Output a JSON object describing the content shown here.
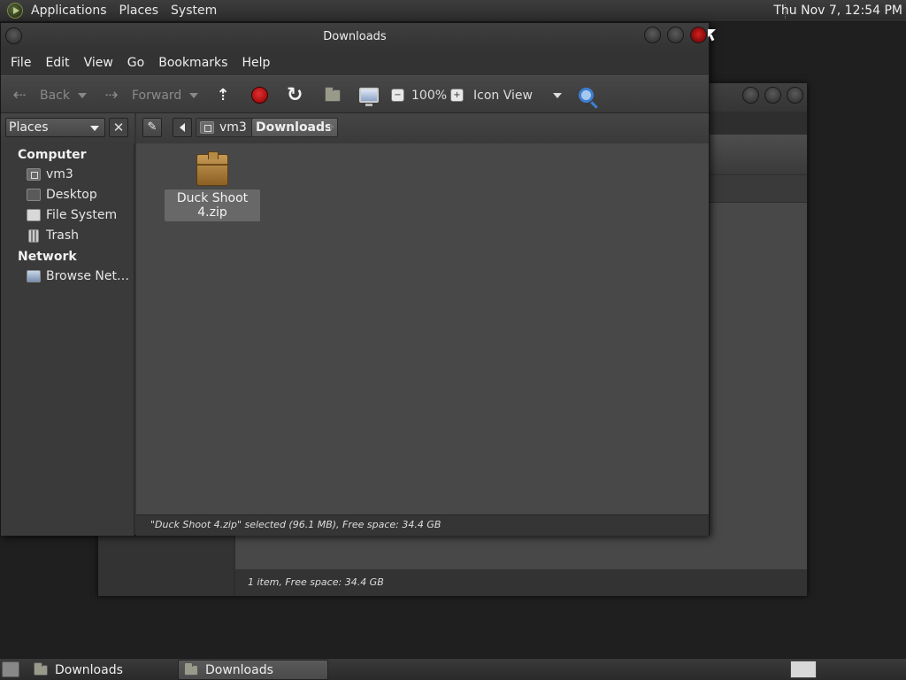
{
  "top_panel": {
    "menus": [
      "Applications",
      "Places",
      "System"
    ],
    "clock": "Thu Nov  7, 12:54 PM"
  },
  "window": {
    "title": "Downloads",
    "menubar": [
      "File",
      "Edit",
      "View",
      "Go",
      "Bookmarks",
      "Help"
    ],
    "toolbar": {
      "back": "Back",
      "forward": "Forward",
      "zoom": "100%",
      "view_mode": "Icon View"
    },
    "sidebar": {
      "combo": "Places",
      "close": "✕",
      "sections": [
        {
          "title": "Computer",
          "items": [
            "vm3",
            "Desktop",
            "File System",
            "Trash"
          ]
        },
        {
          "title": "Network",
          "items": [
            "Browse Net…"
          ]
        }
      ]
    },
    "location": {
      "edit": "✎",
      "crumbs": [
        "vm3",
        "Downloads"
      ]
    },
    "files": [
      {
        "name": "Duck Shoot 4.zip",
        "selected": true
      }
    ],
    "status": "\"Duck Shoot 4.zip\" selected (96.1 MB), Free space: 34.4 GB"
  },
  "background_window": {
    "status": "1 item, Free space: 34.4 GB"
  },
  "taskbar": {
    "tasks": [
      "Downloads",
      "Downloads"
    ],
    "active_index": 1
  },
  "colors": {
    "close_button": "#d42020",
    "selection": "#686868"
  }
}
